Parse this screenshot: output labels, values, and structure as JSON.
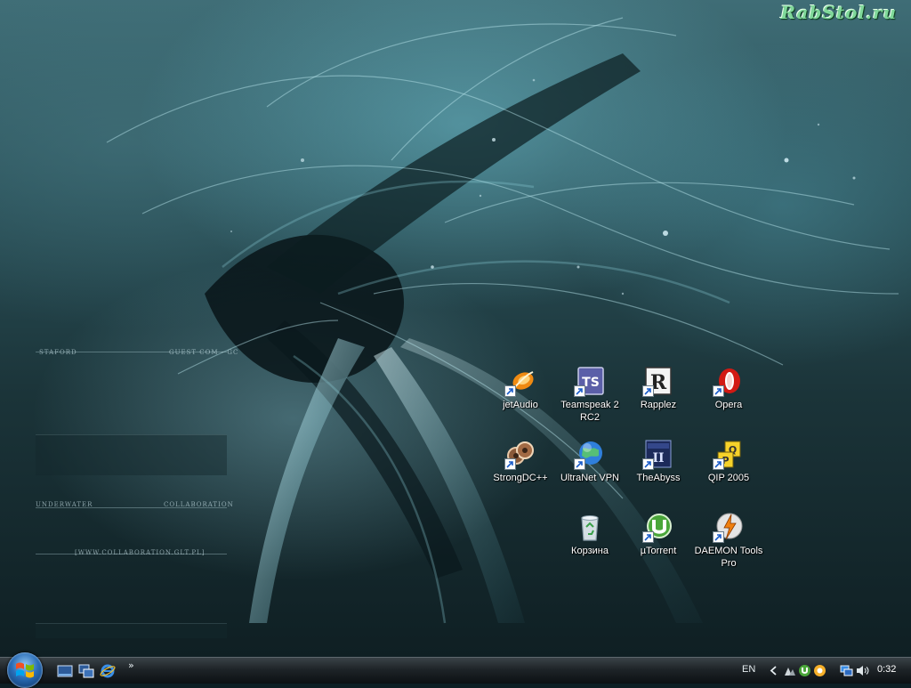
{
  "watermark": "RabStol.ru",
  "wallpaper": {
    "text_left_top": "STAFORD",
    "text_right_top": "GUEST COM - GC",
    "text_left_mid": "UNDERWATER",
    "text_right_mid": "COLLABORATION",
    "url": "[WWW.COLLABORATION.GLT.PL]"
  },
  "desktop_icons": [
    {
      "label": "jetAudio",
      "icon": "jetaudio-icon"
    },
    {
      "label": "Teamspeak 2 RC2",
      "icon": "teamspeak-icon"
    },
    {
      "label": "Rapplez",
      "icon": "rapplez-icon"
    },
    {
      "label": "Opera",
      "icon": "opera-icon"
    },
    {
      "label": "StrongDC++",
      "icon": "strongdc-icon"
    },
    {
      "label": "UltraNet VPN",
      "icon": "globe-icon"
    },
    {
      "label": "TheAbyss",
      "icon": "theabyss-icon"
    },
    {
      "label": "QIP 2005",
      "icon": "qip-icon"
    },
    {
      "label": "Корзина",
      "icon": "recycle-bin-icon"
    },
    {
      "label": "µTorrent",
      "icon": "utorrent-icon"
    },
    {
      "label": "DAEMON Tools Pro",
      "icon": "daemon-tools-icon"
    }
  ],
  "taskbar": {
    "start_icon": "windows-logo-icon",
    "quick_launch": [
      "show-desktop-icon",
      "switch-windows-icon",
      "internet-explorer-icon"
    ],
    "more": "»",
    "language": "EN",
    "tray_icons": [
      "tray-expand-icon",
      "tray-network-icon",
      "tray-utorrent-icon",
      "tray-qip-icon",
      "tray-display-icon",
      "tray-volume-icon"
    ],
    "clock": "0:32"
  },
  "colors": {
    "watermark": "#7fd89a",
    "taskbar_top": "#3a4247",
    "taskbar_bottom": "#0c1013"
  }
}
